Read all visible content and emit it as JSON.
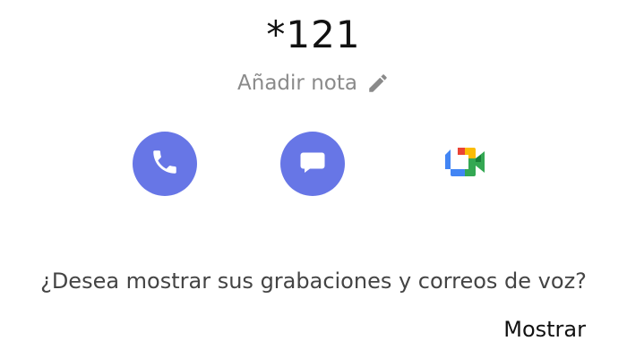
{
  "contact": {
    "title": "*121",
    "note_label": "Añadir nota"
  },
  "actions": [
    {
      "label": "call",
      "icon": "phone-icon",
      "color": "#6776e6"
    },
    {
      "label": "message",
      "icon": "message-icon",
      "color": "#6776e6"
    },
    {
      "label": "video",
      "icon": "google-meet-icon"
    }
  ],
  "recordings_prompt": {
    "question": "¿Desea mostrar sus grabaciones y correos de voz?",
    "button_label": "Mostrar"
  },
  "colors": {
    "accent": "#6776e6",
    "muted_text": "#8a8a8a"
  }
}
